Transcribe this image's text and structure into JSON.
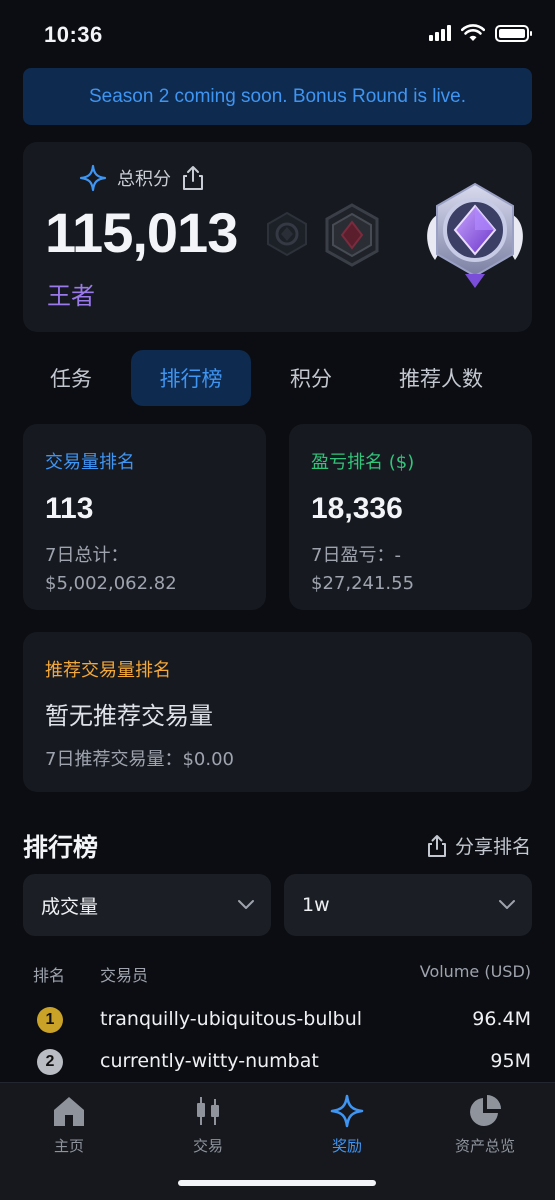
{
  "status_bar": {
    "time": "10:36"
  },
  "banner": {
    "text": "Season 2 coming soon. Bonus Round is live."
  },
  "points": {
    "label": "总积分",
    "value": "115,013",
    "rank_title": "王者"
  },
  "tabs": [
    {
      "label": "任务",
      "active": false
    },
    {
      "label": "排行榜",
      "active": true
    },
    {
      "label": "积分",
      "active": false
    },
    {
      "label": "推荐人数",
      "active": false
    }
  ],
  "stats": {
    "volume": {
      "title": "交易量排名",
      "value": "113",
      "sub_label": "7日总计：",
      "sub_value": "$5,002,062.82"
    },
    "pnl": {
      "title": "盈亏排名 ($)",
      "value": "18,336",
      "sub_label": "7日盈亏：-",
      "sub_value": "$27,241.55"
    }
  },
  "referral": {
    "title": "推荐交易量排名",
    "empty_text": "暂无推荐交易量",
    "sub": "7日推荐交易量：$0.00"
  },
  "leaderboard": {
    "title": "排行榜",
    "share_label": "分享排名",
    "metric_select": "成交量",
    "period_select": "1w",
    "headers": {
      "rank": "排名",
      "trader": "交易员",
      "volume": "Volume (USD)"
    },
    "rows": [
      {
        "rank": "1",
        "trader": "tranquilly-ubiquitous-bulbul",
        "volume": "96.4M"
      },
      {
        "rank": "2",
        "trader": "currently-witty-numbat",
        "volume": "95M"
      }
    ]
  },
  "nav": [
    {
      "label": "主页",
      "icon": "home-icon",
      "active": false
    },
    {
      "label": "交易",
      "icon": "candlestick-icon",
      "active": false
    },
    {
      "label": "奖励",
      "icon": "sparkle-icon",
      "active": true
    },
    {
      "label": "资产总览",
      "icon": "pie-chart-icon",
      "active": false
    }
  ],
  "colors": {
    "accent": "#3f95f2",
    "volume_title": "#3f95f2",
    "pnl_title": "#33c47a",
    "referral_title": "#f3a83a",
    "rank_title": "#9a79ea",
    "gold": "#c9a227",
    "silver": "#b9bcc2"
  }
}
